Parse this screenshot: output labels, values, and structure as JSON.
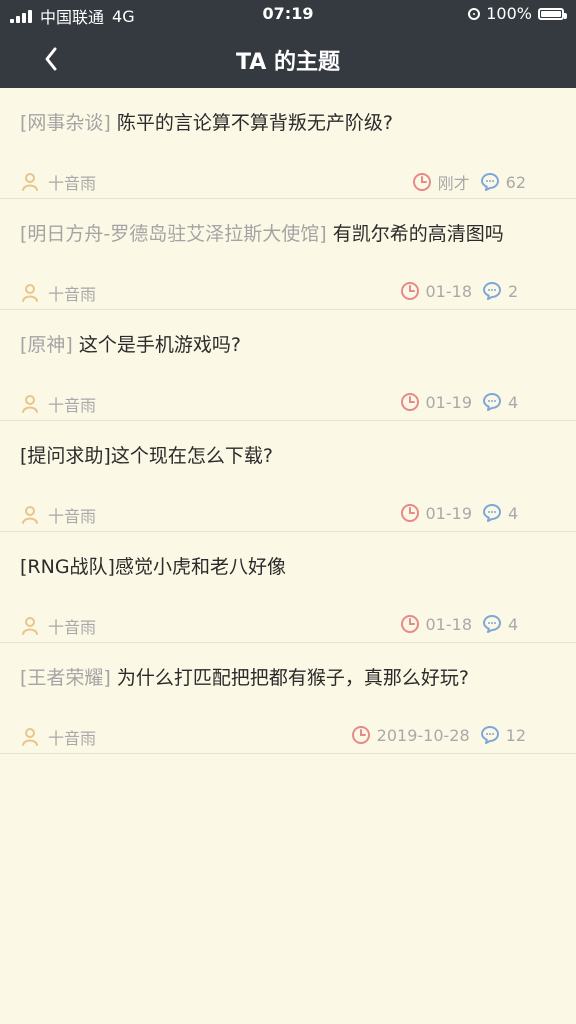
{
  "status_bar": {
    "carrier": "中国联通",
    "network": "4G",
    "time": "07:19",
    "battery": "100%"
  },
  "nav": {
    "title": "TA 的主题"
  },
  "posts": [
    {
      "tag": "[网事杂谈]",
      "title": "陈平的言论算不算背叛无产阶级?",
      "author": "十音雨",
      "time": "刚才",
      "comments": "62"
    },
    {
      "tag": "[明日方舟-罗德岛驻艾泽拉斯大使馆]",
      "title": "有凯尔希的高清图吗",
      "author": "十音雨",
      "time": "01-18",
      "comments": "2"
    },
    {
      "tag": "[原神]",
      "title": "这个是手机游戏吗?",
      "author": "十音雨",
      "time": "01-19",
      "comments": "4"
    },
    {
      "tag": "",
      "title": "[提问求助]这个现在怎么下载?",
      "author": "十音雨",
      "time": "01-19",
      "comments": "4"
    },
    {
      "tag": "",
      "title": "[RNG战队]感觉小虎和老八好像",
      "author": "十音雨",
      "time": "01-18",
      "comments": "4"
    },
    {
      "tag": "[王者荣耀]",
      "title": "为什么打匹配把把都有猴子，真那么好玩?",
      "author": "十音雨",
      "time": "2019-10-28",
      "comments": "12"
    }
  ],
  "icons": {
    "back": "chevron-left-icon",
    "user": "user-icon",
    "time": "clock-icon",
    "comment": "comment-icon"
  },
  "colors": {
    "header_bg": "#343a40",
    "page_bg": "#fcf8e6",
    "user_icon": "#e7c58b",
    "clock_icon": "#e68a8a",
    "comment_icon": "#7ea7d9"
  }
}
